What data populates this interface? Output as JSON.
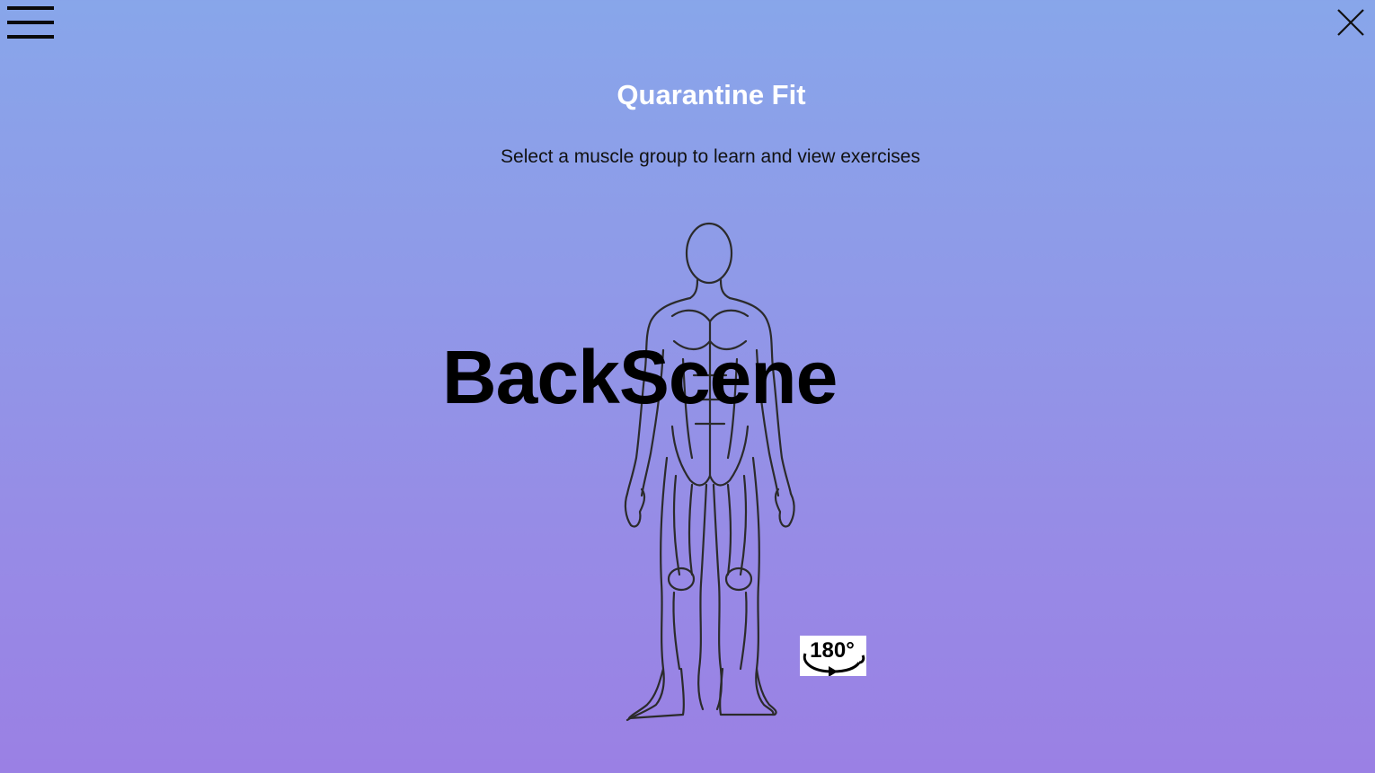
{
  "header": {
    "title": "Quarantine Fit",
    "subtitle": "Select a muscle group to learn and view exercises"
  },
  "scene": {
    "label": "BackScene"
  },
  "controls": {
    "menu_icon": "hamburger-menu-icon",
    "close_icon": "close-icon",
    "rotate_label": "180°",
    "rotate_icon": "rotate-180-icon"
  },
  "colors": {
    "background_top": "#88a6ea",
    "background_bottom": "#9a80e4",
    "title": "#ffffff",
    "subtitle": "#111111",
    "outline": "#2b2b2b"
  }
}
